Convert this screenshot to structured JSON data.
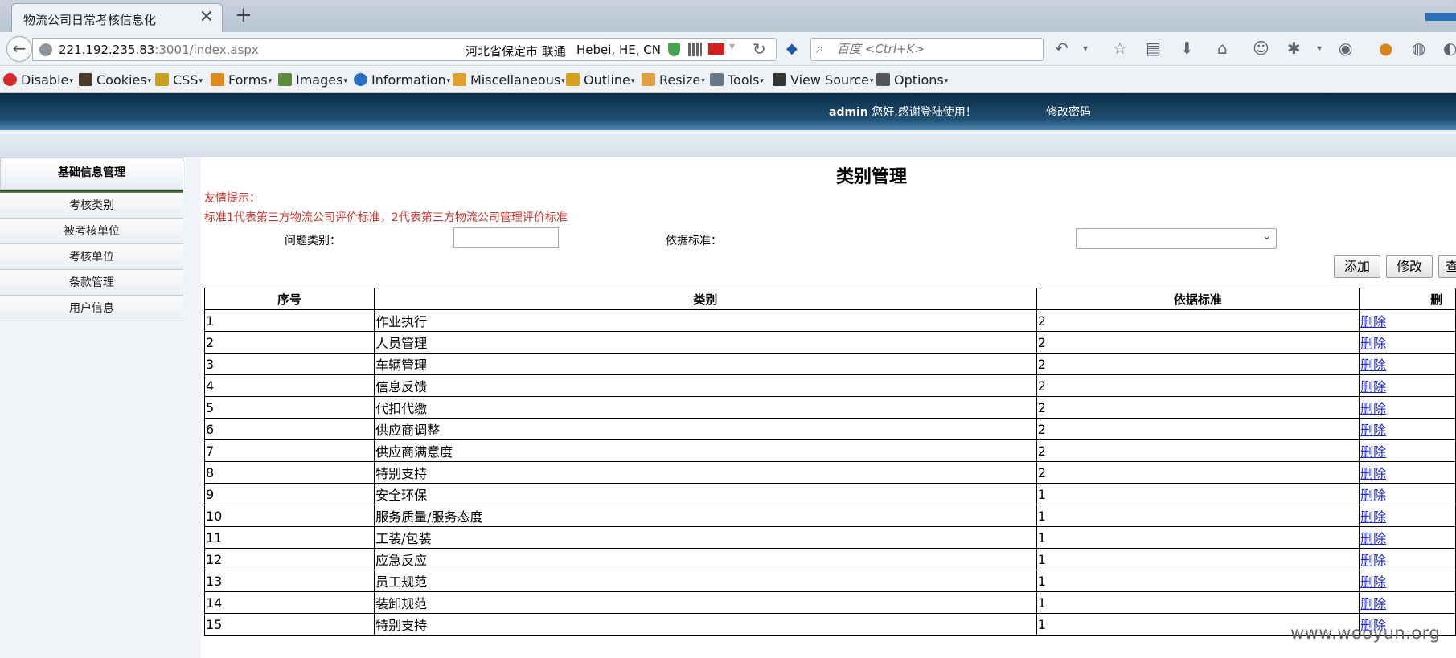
{
  "browser": {
    "tab_title": "物流公司日常考核信息化",
    "url_host": "221.192.235.83",
    "url_path": ":3001/index.aspx",
    "geo_cn": "河北省保定市 联通",
    "geo_en": "Hebei, HE, CN",
    "search_placeholder": "百度 <Ctrl+K>",
    "toolbar": [
      {
        "label": "Disable",
        "icon": "disable-icon",
        "color": "#d62828"
      },
      {
        "label": "Cookies",
        "icon": "cookies-icon",
        "color": "#4a3b2a"
      },
      {
        "label": "CSS",
        "icon": "css-icon",
        "color": "#c8a020"
      },
      {
        "label": "Forms",
        "icon": "forms-icon",
        "color": "#e08a1e"
      },
      {
        "label": "Images",
        "icon": "images-icon",
        "color": "#5f8a3a"
      },
      {
        "label": "Information",
        "icon": "information-icon",
        "color": "#2a6fc4"
      },
      {
        "label": "Miscellaneous",
        "icon": "miscellaneous-icon",
        "color": "#e0a030"
      },
      {
        "label": "Outline",
        "icon": "outline-icon",
        "color": "#d9a020"
      },
      {
        "label": "Resize",
        "icon": "resize-icon",
        "color": "#e0a040"
      },
      {
        "label": "Tools",
        "icon": "tools-icon",
        "color": "#667788"
      },
      {
        "label": "View Source",
        "icon": "view-source-icon",
        "color": "#333333"
      },
      {
        "label": "Options",
        "icon": "options-icon",
        "color": "#555555"
      }
    ]
  },
  "header": {
    "user": "admin",
    "welcome": "您好,感谢登陆使用！",
    "change_password": "修改密码"
  },
  "sidebar": {
    "title": "基础信息管理",
    "items": [
      "考核类别",
      "被考核单位",
      "考核单位",
      "条款管理",
      "用户信息"
    ]
  },
  "main": {
    "title": "类别管理",
    "tip_label": "友情提示：",
    "tip_text": "标准1代表第三方物流公司评价标准，2代表第三方物流公司管理评价标准",
    "category_label": "问题类别：",
    "standard_label": "依据标准：",
    "category_value": "",
    "standard_value": "",
    "buttons": {
      "add": "添加",
      "edit": "修改",
      "query": "查"
    },
    "table": {
      "headers": [
        "序号",
        "类别",
        "依据标准",
        "删"
      ],
      "delete_label": "删除",
      "rows": [
        [
          "1",
          "作业执行",
          "2"
        ],
        [
          "2",
          "人员管理",
          "2"
        ],
        [
          "3",
          "车辆管理",
          "2"
        ],
        [
          "4",
          "信息反馈",
          "2"
        ],
        [
          "5",
          "代扣代缴",
          "2"
        ],
        [
          "6",
          "供应商调整",
          "2"
        ],
        [
          "7",
          "供应商满意度",
          "2"
        ],
        [
          "8",
          "特别支持",
          "2"
        ],
        [
          "9",
          "安全环保",
          "1"
        ],
        [
          "10",
          "服务质量/服务态度",
          "1"
        ],
        [
          "11",
          "工装/包装",
          "1"
        ],
        [
          "12",
          "应急反应",
          "1"
        ],
        [
          "13",
          "员工规范",
          "1"
        ],
        [
          "14",
          "装卸规范",
          "1"
        ],
        [
          "15",
          "特别支持",
          "1"
        ]
      ]
    }
  },
  "watermark": "www.wooyun.org"
}
